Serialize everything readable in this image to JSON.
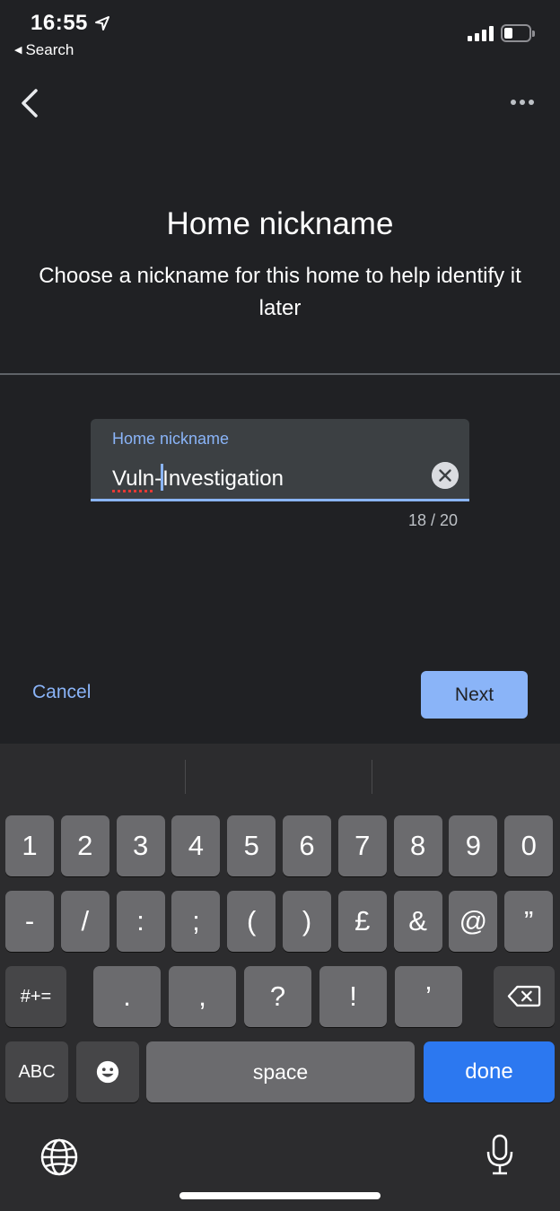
{
  "status_bar": {
    "time": "16:55",
    "back_app": "Search"
  },
  "header": {
    "title": "Home nickname",
    "subtitle": "Choose a nickname for this home to help identify it later"
  },
  "field": {
    "label": "Home nickname",
    "value_before_caret": "Vuln-",
    "value_after_caret": "Investigation",
    "misspelled_word": "Vuln",
    "counter": "18 / 20"
  },
  "actions": {
    "cancel": "Cancel",
    "next": "Next"
  },
  "keyboard": {
    "row1": [
      "1",
      "2",
      "3",
      "4",
      "5",
      "6",
      "7",
      "8",
      "9",
      "0"
    ],
    "row2": [
      "-",
      "/",
      ":",
      ";",
      "(",
      ")",
      "£",
      "&",
      "@",
      "”"
    ],
    "row3_toggle": "#+=",
    "row3": [
      ".",
      ",",
      "?",
      "!",
      "’"
    ],
    "abc": "ABC",
    "space": "space",
    "done": "done"
  },
  "colors": {
    "accent": "#8ab4f8",
    "done_key": "#2c78f0",
    "background": "#202124"
  }
}
